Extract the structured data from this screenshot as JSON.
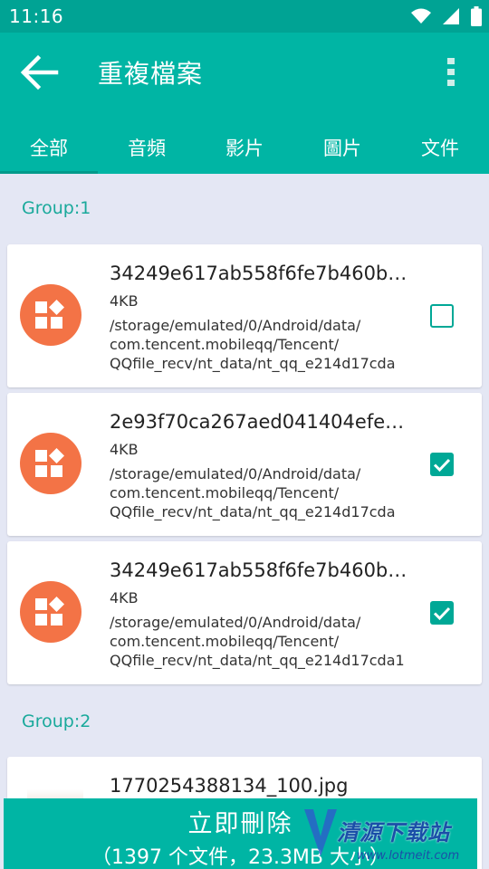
{
  "status_bar": {
    "time": "11:16",
    "icons": [
      "wifi-icon",
      "signal-icon",
      "battery-icon"
    ]
  },
  "app_bar": {
    "title": "重複檔案",
    "back_icon": "arrow-left-icon",
    "more_icon": "more-vertical-icon"
  },
  "tabs": [
    {
      "label": "全部",
      "active": true
    },
    {
      "label": "音頻",
      "active": false
    },
    {
      "label": "影片",
      "active": false
    },
    {
      "label": "圖片",
      "active": false
    },
    {
      "label": "文件",
      "active": false
    }
  ],
  "groups": [
    {
      "label": "Group:1",
      "files": [
        {
          "name": "34249e617ab558f6fe7b460b5...",
          "size": "4KB",
          "path": [
            "/storage/emulated/0/Android/data/",
            "com.tencent.mobileqq/Tencent/",
            "QQfile_recv/nt_data/nt_qq_e214d17cda"
          ],
          "checked": false,
          "icon": "file-app-icon"
        },
        {
          "name": "2e93f70ca267aed041404efe9...",
          "size": "4KB",
          "path": [
            "/storage/emulated/0/Android/data/",
            "com.tencent.mobileqq/Tencent/",
            "QQfile_recv/nt_data/nt_qq_e214d17cda"
          ],
          "checked": true,
          "icon": "file-app-icon"
        },
        {
          "name": "34249e617ab558f6fe7b460b5...",
          "size": "4KB",
          "path": [
            "/storage/emulated/0/Android/data/",
            "com.tencent.mobileqq/Tencent/",
            "QQfile_recv/nt_data/nt_qq_e214d17cda1"
          ],
          "checked": true,
          "icon": "file-app-icon"
        }
      ]
    },
    {
      "label": "Group:2",
      "files": [
        {
          "name": "1770254388134_100.jpg",
          "icon": "image-thumbnail"
        }
      ]
    }
  ],
  "delete_button": {
    "label": "立即刪除",
    "summary": "（1397 个文件，23.3MB 大小）"
  },
  "watermark": {
    "text": "清源下载站",
    "url": "www.lotmeit.com"
  },
  "colors": {
    "primary": "#00b5a4",
    "status_bar": "#00a394",
    "accent": "#00a896",
    "file_icon_bg": "#f37346",
    "group_bg": "#e4e7f4",
    "group_label": "#19a99b"
  }
}
